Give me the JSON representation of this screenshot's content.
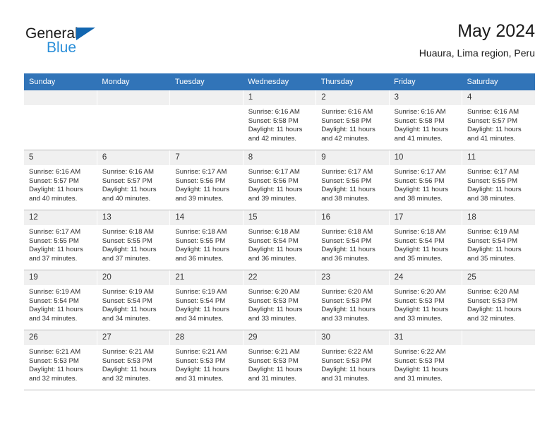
{
  "brand": {
    "name_part1": "General",
    "name_part2": "Blue",
    "triangle_color": "#1266b0",
    "blue_color": "#2b8fd9"
  },
  "header": {
    "title": "May 2024",
    "subtitle": "Huaura, Lima region, Peru",
    "header_bg": "#3174b8"
  },
  "weekdays": [
    "Sunday",
    "Monday",
    "Tuesday",
    "Wednesday",
    "Thursday",
    "Friday",
    "Saturday"
  ],
  "weeks": [
    [
      {
        "day": "",
        "blank": true,
        "sunrise": "",
        "sunset": "",
        "daylight_line1": "",
        "daylight_line2": ""
      },
      {
        "day": "",
        "blank": true,
        "sunrise": "",
        "sunset": "",
        "daylight_line1": "",
        "daylight_line2": ""
      },
      {
        "day": "",
        "blank": true,
        "sunrise": "",
        "sunset": "",
        "daylight_line1": "",
        "daylight_line2": ""
      },
      {
        "day": "1",
        "blank": false,
        "sunrise": "Sunrise: 6:16 AM",
        "sunset": "Sunset: 5:58 PM",
        "daylight_line1": "Daylight: 11 hours",
        "daylight_line2": "and 42 minutes."
      },
      {
        "day": "2",
        "blank": false,
        "sunrise": "Sunrise: 6:16 AM",
        "sunset": "Sunset: 5:58 PM",
        "daylight_line1": "Daylight: 11 hours",
        "daylight_line2": "and 42 minutes."
      },
      {
        "day": "3",
        "blank": false,
        "sunrise": "Sunrise: 6:16 AM",
        "sunset": "Sunset: 5:58 PM",
        "daylight_line1": "Daylight: 11 hours",
        "daylight_line2": "and 41 minutes."
      },
      {
        "day": "4",
        "blank": false,
        "sunrise": "Sunrise: 6:16 AM",
        "sunset": "Sunset: 5:57 PM",
        "daylight_line1": "Daylight: 11 hours",
        "daylight_line2": "and 41 minutes."
      }
    ],
    [
      {
        "day": "5",
        "blank": false,
        "sunrise": "Sunrise: 6:16 AM",
        "sunset": "Sunset: 5:57 PM",
        "daylight_line1": "Daylight: 11 hours",
        "daylight_line2": "and 40 minutes."
      },
      {
        "day": "6",
        "blank": false,
        "sunrise": "Sunrise: 6:16 AM",
        "sunset": "Sunset: 5:57 PM",
        "daylight_line1": "Daylight: 11 hours",
        "daylight_line2": "and 40 minutes."
      },
      {
        "day": "7",
        "blank": false,
        "sunrise": "Sunrise: 6:17 AM",
        "sunset": "Sunset: 5:56 PM",
        "daylight_line1": "Daylight: 11 hours",
        "daylight_line2": "and 39 minutes."
      },
      {
        "day": "8",
        "blank": false,
        "sunrise": "Sunrise: 6:17 AM",
        "sunset": "Sunset: 5:56 PM",
        "daylight_line1": "Daylight: 11 hours",
        "daylight_line2": "and 39 minutes."
      },
      {
        "day": "9",
        "blank": false,
        "sunrise": "Sunrise: 6:17 AM",
        "sunset": "Sunset: 5:56 PM",
        "daylight_line1": "Daylight: 11 hours",
        "daylight_line2": "and 38 minutes."
      },
      {
        "day": "10",
        "blank": false,
        "sunrise": "Sunrise: 6:17 AM",
        "sunset": "Sunset: 5:56 PM",
        "daylight_line1": "Daylight: 11 hours",
        "daylight_line2": "and 38 minutes."
      },
      {
        "day": "11",
        "blank": false,
        "sunrise": "Sunrise: 6:17 AM",
        "sunset": "Sunset: 5:55 PM",
        "daylight_line1": "Daylight: 11 hours",
        "daylight_line2": "and 38 minutes."
      }
    ],
    [
      {
        "day": "12",
        "blank": false,
        "sunrise": "Sunrise: 6:17 AM",
        "sunset": "Sunset: 5:55 PM",
        "daylight_line1": "Daylight: 11 hours",
        "daylight_line2": "and 37 minutes."
      },
      {
        "day": "13",
        "blank": false,
        "sunrise": "Sunrise: 6:18 AM",
        "sunset": "Sunset: 5:55 PM",
        "daylight_line1": "Daylight: 11 hours",
        "daylight_line2": "and 37 minutes."
      },
      {
        "day": "14",
        "blank": false,
        "sunrise": "Sunrise: 6:18 AM",
        "sunset": "Sunset: 5:55 PM",
        "daylight_line1": "Daylight: 11 hours",
        "daylight_line2": "and 36 minutes."
      },
      {
        "day": "15",
        "blank": false,
        "sunrise": "Sunrise: 6:18 AM",
        "sunset": "Sunset: 5:54 PM",
        "daylight_line1": "Daylight: 11 hours",
        "daylight_line2": "and 36 minutes."
      },
      {
        "day": "16",
        "blank": false,
        "sunrise": "Sunrise: 6:18 AM",
        "sunset": "Sunset: 5:54 PM",
        "daylight_line1": "Daylight: 11 hours",
        "daylight_line2": "and 36 minutes."
      },
      {
        "day": "17",
        "blank": false,
        "sunrise": "Sunrise: 6:18 AM",
        "sunset": "Sunset: 5:54 PM",
        "daylight_line1": "Daylight: 11 hours",
        "daylight_line2": "and 35 minutes."
      },
      {
        "day": "18",
        "blank": false,
        "sunrise": "Sunrise: 6:19 AM",
        "sunset": "Sunset: 5:54 PM",
        "daylight_line1": "Daylight: 11 hours",
        "daylight_line2": "and 35 minutes."
      }
    ],
    [
      {
        "day": "19",
        "blank": false,
        "sunrise": "Sunrise: 6:19 AM",
        "sunset": "Sunset: 5:54 PM",
        "daylight_line1": "Daylight: 11 hours",
        "daylight_line2": "and 34 minutes."
      },
      {
        "day": "20",
        "blank": false,
        "sunrise": "Sunrise: 6:19 AM",
        "sunset": "Sunset: 5:54 PM",
        "daylight_line1": "Daylight: 11 hours",
        "daylight_line2": "and 34 minutes."
      },
      {
        "day": "21",
        "blank": false,
        "sunrise": "Sunrise: 6:19 AM",
        "sunset": "Sunset: 5:54 PM",
        "daylight_line1": "Daylight: 11 hours",
        "daylight_line2": "and 34 minutes."
      },
      {
        "day": "22",
        "blank": false,
        "sunrise": "Sunrise: 6:20 AM",
        "sunset": "Sunset: 5:53 PM",
        "daylight_line1": "Daylight: 11 hours",
        "daylight_line2": "and 33 minutes."
      },
      {
        "day": "23",
        "blank": false,
        "sunrise": "Sunrise: 6:20 AM",
        "sunset": "Sunset: 5:53 PM",
        "daylight_line1": "Daylight: 11 hours",
        "daylight_line2": "and 33 minutes."
      },
      {
        "day": "24",
        "blank": false,
        "sunrise": "Sunrise: 6:20 AM",
        "sunset": "Sunset: 5:53 PM",
        "daylight_line1": "Daylight: 11 hours",
        "daylight_line2": "and 33 minutes."
      },
      {
        "day": "25",
        "blank": false,
        "sunrise": "Sunrise: 6:20 AM",
        "sunset": "Sunset: 5:53 PM",
        "daylight_line1": "Daylight: 11 hours",
        "daylight_line2": "and 32 minutes."
      }
    ],
    [
      {
        "day": "26",
        "blank": false,
        "sunrise": "Sunrise: 6:21 AM",
        "sunset": "Sunset: 5:53 PM",
        "daylight_line1": "Daylight: 11 hours",
        "daylight_line2": "and 32 minutes."
      },
      {
        "day": "27",
        "blank": false,
        "sunrise": "Sunrise: 6:21 AM",
        "sunset": "Sunset: 5:53 PM",
        "daylight_line1": "Daylight: 11 hours",
        "daylight_line2": "and 32 minutes."
      },
      {
        "day": "28",
        "blank": false,
        "sunrise": "Sunrise: 6:21 AM",
        "sunset": "Sunset: 5:53 PM",
        "daylight_line1": "Daylight: 11 hours",
        "daylight_line2": "and 31 minutes."
      },
      {
        "day": "29",
        "blank": false,
        "sunrise": "Sunrise: 6:21 AM",
        "sunset": "Sunset: 5:53 PM",
        "daylight_line1": "Daylight: 11 hours",
        "daylight_line2": "and 31 minutes."
      },
      {
        "day": "30",
        "blank": false,
        "sunrise": "Sunrise: 6:22 AM",
        "sunset": "Sunset: 5:53 PM",
        "daylight_line1": "Daylight: 11 hours",
        "daylight_line2": "and 31 minutes."
      },
      {
        "day": "31",
        "blank": false,
        "sunrise": "Sunrise: 6:22 AM",
        "sunset": "Sunset: 5:53 PM",
        "daylight_line1": "Daylight: 11 hours",
        "daylight_line2": "and 31 minutes."
      },
      {
        "day": "",
        "blank": true,
        "sunrise": "",
        "sunset": "",
        "daylight_line1": "",
        "daylight_line2": ""
      }
    ]
  ]
}
